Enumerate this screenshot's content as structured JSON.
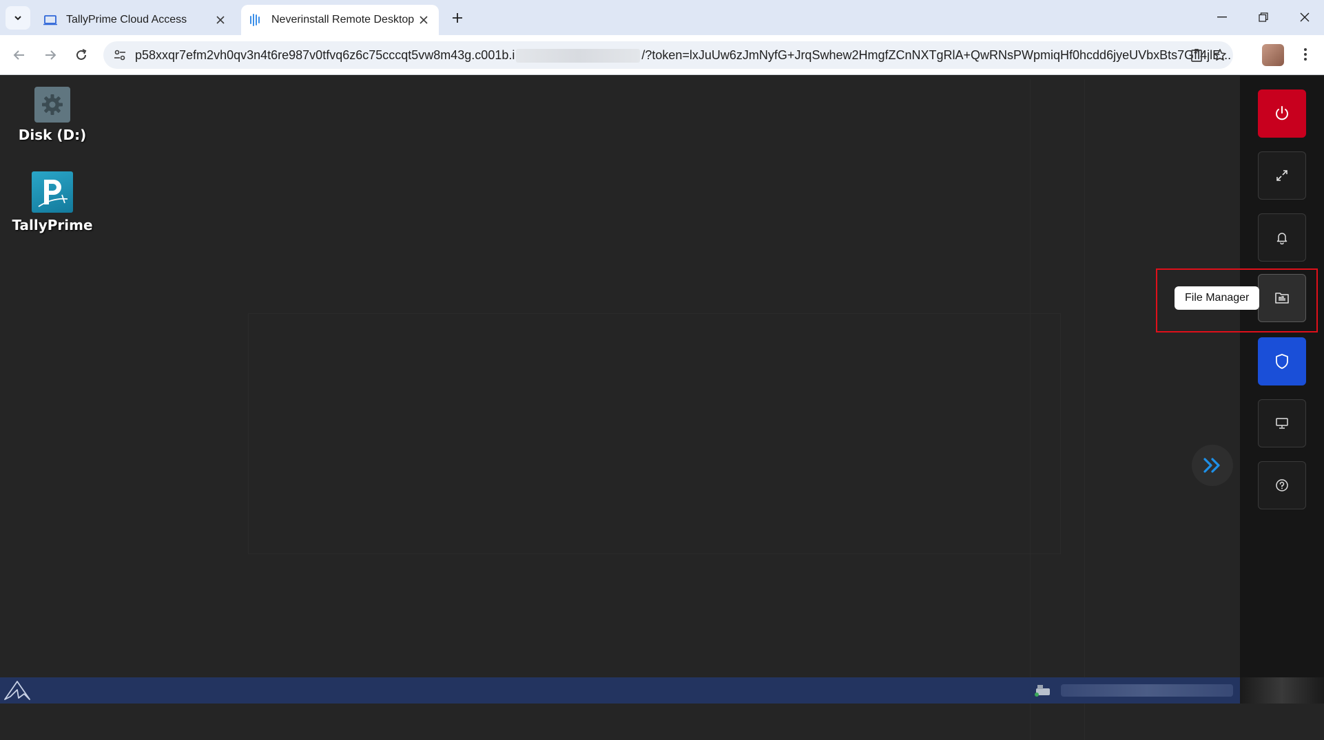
{
  "browser": {
    "tabs": [
      {
        "title": "TallyPrime Cloud Access",
        "active": false
      },
      {
        "title": "Neverinstall Remote Desktop",
        "active": true
      }
    ],
    "url_start": "p58xxqr7efm2vh0qv3n4t6re987v0tfvq6z6c75cccqt5vw8m43g.c001b.i",
    "url_end": "/?token=lxJuUw6zJmNyfG+JrqSwhew2HmgfZCnNXTgRlA+QwRNsPWpmiqHf0hcdd6jyeUVbxBts7Gfl4jlE..."
  },
  "desktop": {
    "icons": [
      {
        "label": "Disk (D:)",
        "icon": "settings-gear-icon"
      },
      {
        "label": "TallyPrime",
        "icon": "tallyprime-logo-icon"
      }
    ]
  },
  "side_panel": {
    "buttons": [
      {
        "name": "power",
        "icon": "power-icon",
        "color": "#c8001e"
      },
      {
        "name": "fullscreen",
        "icon": "expand-arrows-icon"
      },
      {
        "name": "notifications",
        "icon": "bell-icon"
      },
      {
        "name": "file-manager",
        "icon": "folder-icon"
      },
      {
        "name": "security",
        "icon": "shield-icon",
        "color": "#1a4fd8"
      },
      {
        "name": "display",
        "icon": "monitor-icon"
      },
      {
        "name": "help",
        "icon": "help-circle-icon"
      }
    ],
    "tooltip": "File Manager"
  },
  "colors": {
    "accent_blue": "#1a4fd8",
    "power_red": "#c8001e",
    "highlight_red": "#e0101a",
    "expand_arrow_blue": "#1e90e8",
    "taskbar": "#233460"
  }
}
